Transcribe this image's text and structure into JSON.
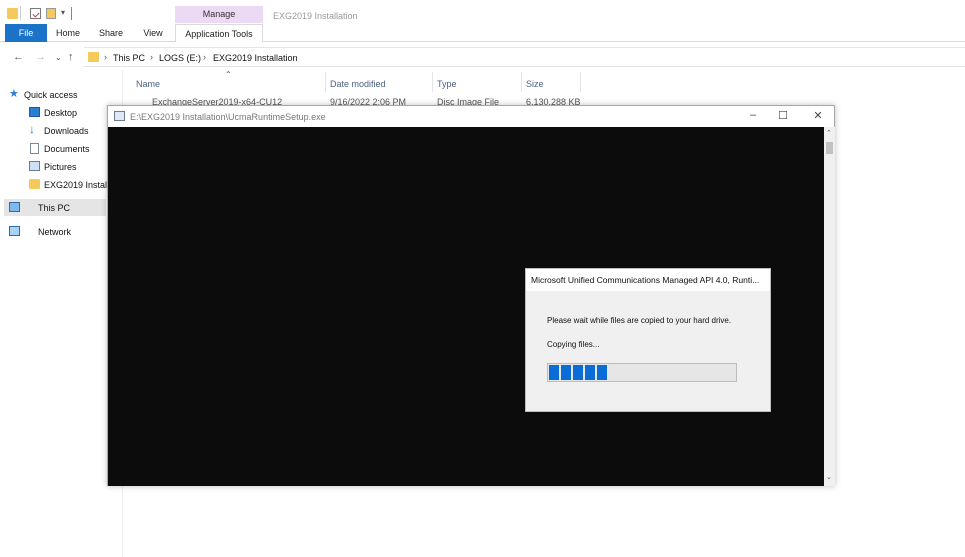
{
  "quick_access_toolbar": {
    "folder_icon": "folder-icon",
    "properties_icon": "properties-check-icon",
    "customize_icon": "dropdown-icon"
  },
  "ribbon": {
    "contextual_group_label": "Manage",
    "window_title": "EXG2019 Installation",
    "tabs": [
      {
        "label": "File",
        "active_color": "#1a73c7"
      },
      {
        "label": "Home"
      },
      {
        "label": "Share"
      },
      {
        "label": "View"
      },
      {
        "label": "Application Tools"
      }
    ]
  },
  "address_bar": {
    "back_icon": "back-arrow-icon",
    "forward_icon": "forward-arrow-icon",
    "recent_icon": "chevron-down-icon",
    "up_icon": "up-arrow-icon",
    "breadcrumbs": [
      "This PC",
      "LOGS (E:)",
      "EXG2019 Installation"
    ]
  },
  "sidebar": {
    "items": [
      {
        "label": "Quick access",
        "icon": "star-icon"
      },
      {
        "label": "Desktop",
        "icon": "desktop-icon"
      },
      {
        "label": "Downloads",
        "icon": "download-arrow-icon"
      },
      {
        "label": "Documents",
        "icon": "documents-icon"
      },
      {
        "label": "Pictures",
        "icon": "pictures-icon"
      },
      {
        "label": "EXG2019 Installa",
        "icon": "folder-icon"
      },
      {
        "label": "This PC",
        "icon": "computer-icon",
        "selected": true
      },
      {
        "label": "Network",
        "icon": "network-icon"
      }
    ]
  },
  "file_list": {
    "columns": [
      "Name",
      "Date modified",
      "Type",
      "Size"
    ],
    "rows": [
      {
        "name": "ExchangeServer2019-x64-CU12",
        "date": "9/16/2022 2:06 PM",
        "type": "Disc Image File",
        "size": "6,130,288 KB"
      }
    ]
  },
  "console_window": {
    "title": "E:\\EXG2019 Installation\\UcmaRuntimeSetup.exe",
    "icon": "setup-app-icon",
    "background": "#0c0c0c"
  },
  "setup_dialog": {
    "title": "Microsoft Unified Communications Managed API 4.0, Runti...",
    "message": "Please wait while files are copied to your hard drive.",
    "status": "Copying files...",
    "progress_segments": 5,
    "progress_percent": 32,
    "progress_color": "#0a6cd4"
  }
}
